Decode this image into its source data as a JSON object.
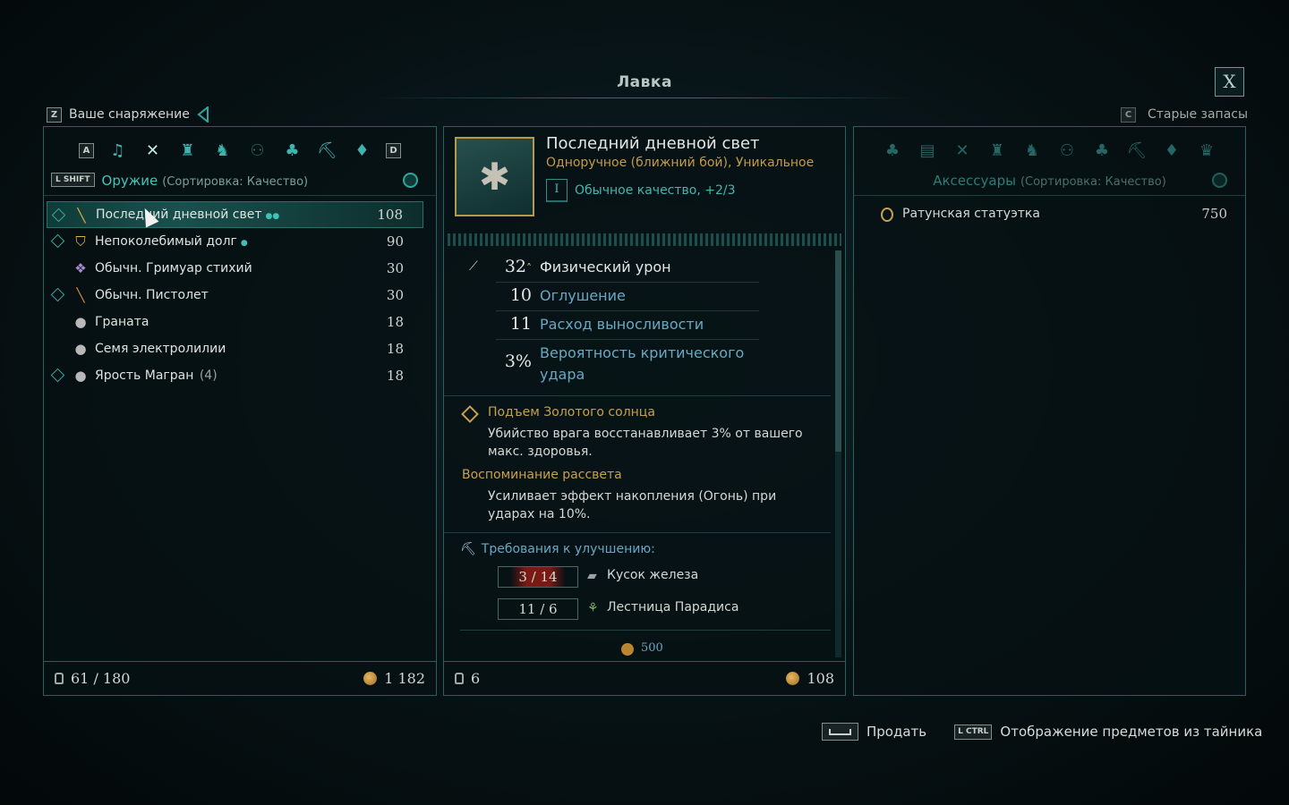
{
  "window": {
    "title": "Лавка",
    "close_label": "X"
  },
  "left_header": {
    "key": "Z",
    "label": "Ваше снаряжение"
  },
  "right_header": {
    "key": "C",
    "label": "Старые запасы"
  },
  "left_panel": {
    "nav_left_key": "A",
    "nav_right_key": "D",
    "category_icons": [
      "bell-icon",
      "crossed-axes-icon",
      "armor-icon",
      "boots-icon",
      "amulet-icon",
      "potion-icon",
      "anvil-icon",
      "gem-icon"
    ],
    "sort_key": "L SHIFT",
    "category_title": "Оружие",
    "sort_text": "(Сортировка: Качество)",
    "items": [
      {
        "name": "Последний дневной свет",
        "value": "108",
        "dots": "●●",
        "qty": "",
        "icon": "sword-icon",
        "glyph": "╲",
        "color": "#e0b23d",
        "diamond": true,
        "selected": true
      },
      {
        "name": "Непоколебимый долг",
        "value": "90",
        "dots": "●",
        "qty": "",
        "icon": "shield-icon",
        "glyph": "⛉",
        "color": "#e0b23d",
        "diamond": true,
        "selected": false
      },
      {
        "name": "Обычн. Гримуар стихий",
        "value": "30",
        "dots": "",
        "qty": "",
        "icon": "grimoire-icon",
        "glyph": "❖",
        "color": "#a98bd6",
        "diamond": false,
        "selected": false
      },
      {
        "name": "Обычн. Пистолет",
        "value": "30",
        "dots": "",
        "qty": "",
        "icon": "pistol-icon",
        "glyph": "╲",
        "color": "#d08a45",
        "diamond": true,
        "selected": false
      },
      {
        "name": "Граната",
        "value": "18",
        "dots": "",
        "qty": "",
        "icon": "grenade-icon",
        "glyph": "●",
        "color": "#b8b8b8",
        "diamond": false,
        "selected": false
      },
      {
        "name": "Семя электролилии",
        "value": "18",
        "dots": "",
        "qty": "",
        "icon": "seed-icon",
        "glyph": "●",
        "color": "#b8b8b8",
        "diamond": false,
        "selected": false
      },
      {
        "name": "Ярость Магран",
        "value": "18",
        "dots": "",
        "qty": "(4)",
        "icon": "bomb-icon",
        "glyph": "●",
        "color": "#b8b8b8",
        "diamond": true,
        "selected": false
      }
    ],
    "footer": {
      "capacity": "61 / 180",
      "gold": "1 182"
    }
  },
  "detail": {
    "name": "Последний дневной свет",
    "type": "Одноручное (ближний бой), Уникальное",
    "quality_badge": "I",
    "quality": "Обычное качество, +2/3",
    "stats": [
      {
        "value": "32",
        "suffix": "˄",
        "name": "Физический урон"
      },
      {
        "value": "10",
        "name": "Оглушение"
      },
      {
        "value": "11",
        "name": "Расход выносливости"
      },
      {
        "value": "3%",
        "name": "Вероятность критического удара"
      }
    ],
    "perk1": {
      "title": "Подъем Золотого солнца",
      "desc": "Убийство врага восстанавливает 3% от вашего макс. здоровья."
    },
    "perk2": {
      "title": "Воспоминание рассвета",
      "desc": "Усиливает эффект накопления (Огонь) при ударах на 10%."
    },
    "requirements": {
      "title": "Требования к улучшению:",
      "rows": [
        {
          "amount": "3 / 14",
          "name": "Кусок железа",
          "insufficient": true
        },
        {
          "amount": "11 / 6",
          "name": "Лестница Парадиса",
          "insufficient": false
        }
      ],
      "cut_gold": "500"
    },
    "footer": {
      "count": "6",
      "price": "108"
    }
  },
  "right_panel": {
    "category_title": "Аксессуары",
    "sort_text": "(Сортировка: Качество)",
    "items": [
      {
        "name": "Ратунская статуэтка",
        "value": "750"
      }
    ]
  },
  "actions": {
    "sell_label": "Продать",
    "stash_key": "L CTRL",
    "stash_label": "Отображение предметов из тайника"
  }
}
